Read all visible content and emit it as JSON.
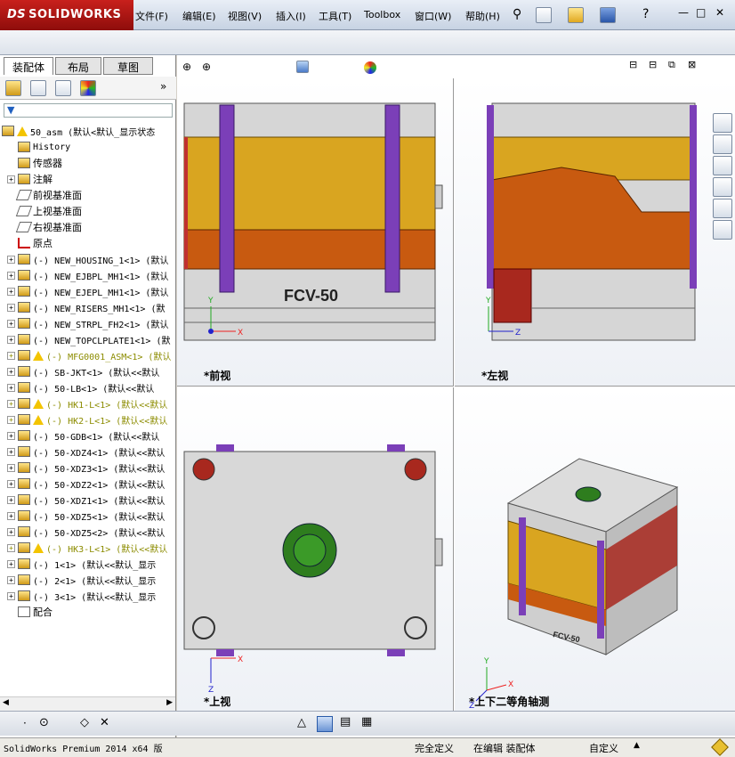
{
  "app": {
    "logo": "SOLIDWORKS",
    "logo_ds": "DS"
  },
  "menu": [
    "文件(F)",
    "编辑(E)",
    "视图(V)",
    "插入(I)",
    "工具(T)",
    "Toolbox",
    "窗口(W)",
    "帮助(H)"
  ],
  "window_controls": {
    "min": "—",
    "restore": "□",
    "close": "✕",
    "help": "?"
  },
  "panel": {
    "tabs": [
      "装配体",
      "布局",
      "草图"
    ],
    "tree": [
      {
        "t": "50_asm  (默认<默认_显示状态",
        "type": "root",
        "warn": true
      },
      {
        "t": "History",
        "type": "sub",
        "cn": false
      },
      {
        "t": "传感器",
        "type": "sub",
        "cn": true
      },
      {
        "t": "注解",
        "type": "sub",
        "cn": true,
        "pm": true
      },
      {
        "t": "前视基准面",
        "type": "plane",
        "cn": true
      },
      {
        "t": "上视基准面",
        "type": "plane",
        "cn": true
      },
      {
        "t": "右视基准面",
        "type": "plane",
        "cn": true
      },
      {
        "t": "原点",
        "type": "origin",
        "cn": true
      },
      {
        "t": "(-) NEW_HOUSING_1<1> (默认",
        "type": "part"
      },
      {
        "t": "(-) NEW_EJBPL_MH1<1> (默认",
        "type": "part"
      },
      {
        "t": "(-) NEW_EJEPL_MH1<1> (默认",
        "type": "part"
      },
      {
        "t": "(-) NEW_RISERS_MH1<1> (默",
        "type": "part"
      },
      {
        "t": "(-) NEW_STRPL_FH2<1> (默认",
        "type": "part"
      },
      {
        "t": "(-) NEW_TOPCLPLATE1<1> (默",
        "type": "part"
      },
      {
        "t": "(-) MFG0001_ASM<1> (默认",
        "type": "part",
        "warn": true,
        "y": true
      },
      {
        "t": "(-) SB-JKT<1> (默认<<默认",
        "type": "part"
      },
      {
        "t": "(-) 50-LB<1> (默认<<默认",
        "type": "part"
      },
      {
        "t": "(-) HK1-L<1> (默认<<默认",
        "type": "part",
        "warn": true,
        "y": true
      },
      {
        "t": "(-) HK2-L<1> (默认<<默认",
        "type": "part",
        "warn": true,
        "y": true
      },
      {
        "t": "(-) 50-GDB<1> (默认<<默认",
        "type": "part"
      },
      {
        "t": "(-) 50-XDZ4<1> (默认<<默认",
        "type": "part"
      },
      {
        "t": "(-) 50-XDZ3<1> (默认<<默认",
        "type": "part"
      },
      {
        "t": "(-) 50-XDZ2<1> (默认<<默认",
        "type": "part"
      },
      {
        "t": "(-) 50-XDZ1<1> (默认<<默认",
        "type": "part"
      },
      {
        "t": "(-) 50-XDZ5<1> (默认<<默认",
        "type": "part"
      },
      {
        "t": "(-) 50-XDZ5<2> (默认<<默认",
        "type": "part"
      },
      {
        "t": "(-) HK3-L<1> (默认<<默认",
        "type": "part",
        "warn": true,
        "y": true
      },
      {
        "t": "(-) 1<1> (默认<<默认_显示",
        "type": "part"
      },
      {
        "t": "(-) 2<1> (默认<<默认_显示",
        "type": "part"
      },
      {
        "t": "(-) 3<1> (默认<<默认_显示",
        "type": "part"
      },
      {
        "t": "配合",
        "type": "mate",
        "cn": true
      }
    ]
  },
  "views": {
    "front": "*前视",
    "left": "*左视",
    "top": "*上视",
    "iso": "*上下二等角轴测"
  },
  "part_label": "FCV-50",
  "axis": {
    "x": "X",
    "y": "Y",
    "z": "Z"
  },
  "status": {
    "product": "SolidWorks Premium 2014 x64 版",
    "s1": "完全定义",
    "s2": "在编辑 装配体",
    "s3": "自定义"
  },
  "colors": {
    "plate": "#d8d8d8",
    "gold": "#d9a520",
    "orange": "#c85a10",
    "purple": "#7b3fb8",
    "darkred": "#a8281e"
  }
}
